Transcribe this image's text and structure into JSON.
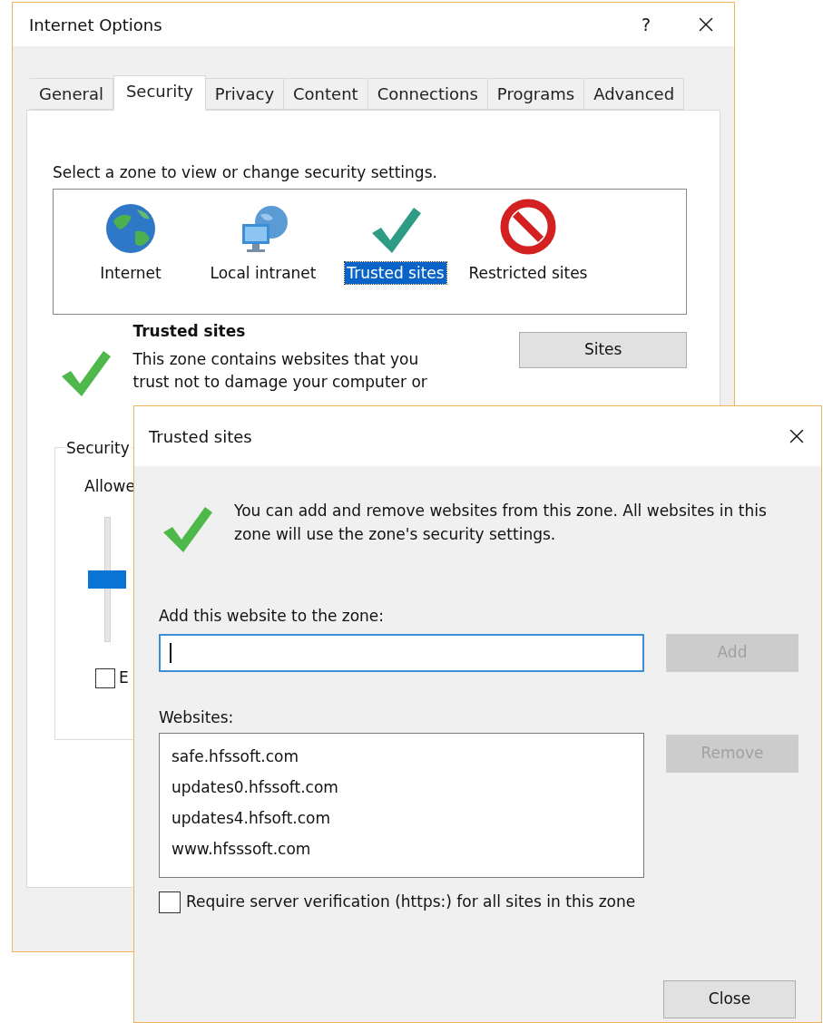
{
  "main_window": {
    "title": "Internet Options",
    "help_label": "?",
    "tabs": [
      {
        "label": "General",
        "selected": false
      },
      {
        "label": "Security",
        "selected": true
      },
      {
        "label": "Privacy",
        "selected": false
      },
      {
        "label": "Content",
        "selected": false
      },
      {
        "label": "Connections",
        "selected": false
      },
      {
        "label": "Programs",
        "selected": false
      },
      {
        "label": "Advanced",
        "selected": false
      }
    ],
    "zone_prompt": "Select a zone to view or change security settings.",
    "zones": [
      {
        "label": "Internet",
        "kind": "globe",
        "selected": false
      },
      {
        "label": "Local intranet",
        "kind": "intranet",
        "selected": false
      },
      {
        "label": "Trusted sites",
        "kind": "check",
        "selected": true
      },
      {
        "label": "Restricted sites",
        "kind": "blocked",
        "selected": false
      }
    ],
    "zone_info": {
      "title": "Trusted sites",
      "description": "This zone contains websites that you trust not to damage your computer or"
    },
    "sites_button": "Sites",
    "security_level": {
      "group_label": "Security",
      "allowed_label": "Allowe",
      "level": 0.5
    },
    "enable_checkbox": {
      "label": "E",
      "checked": false
    }
  },
  "dialog": {
    "title": "Trusted sites",
    "message": "You can add and remove websites from this zone. All websites in this zone will use the zone's security settings.",
    "add_label": "Add this website to the zone:",
    "add_button": {
      "label": "Add",
      "disabled": true
    },
    "websites_label": "Websites:",
    "websites": [
      "safe.hfssoft.com",
      "updates0.hfssoft.com",
      "updates4.hfsoft.com",
      "www.hfsssoft.com"
    ],
    "remove_button": {
      "label": "Remove",
      "disabled": true
    },
    "https_checkbox": {
      "label": "Require server verification (https:) for all sites in this zone",
      "checked": false
    },
    "close_button": "Close"
  }
}
